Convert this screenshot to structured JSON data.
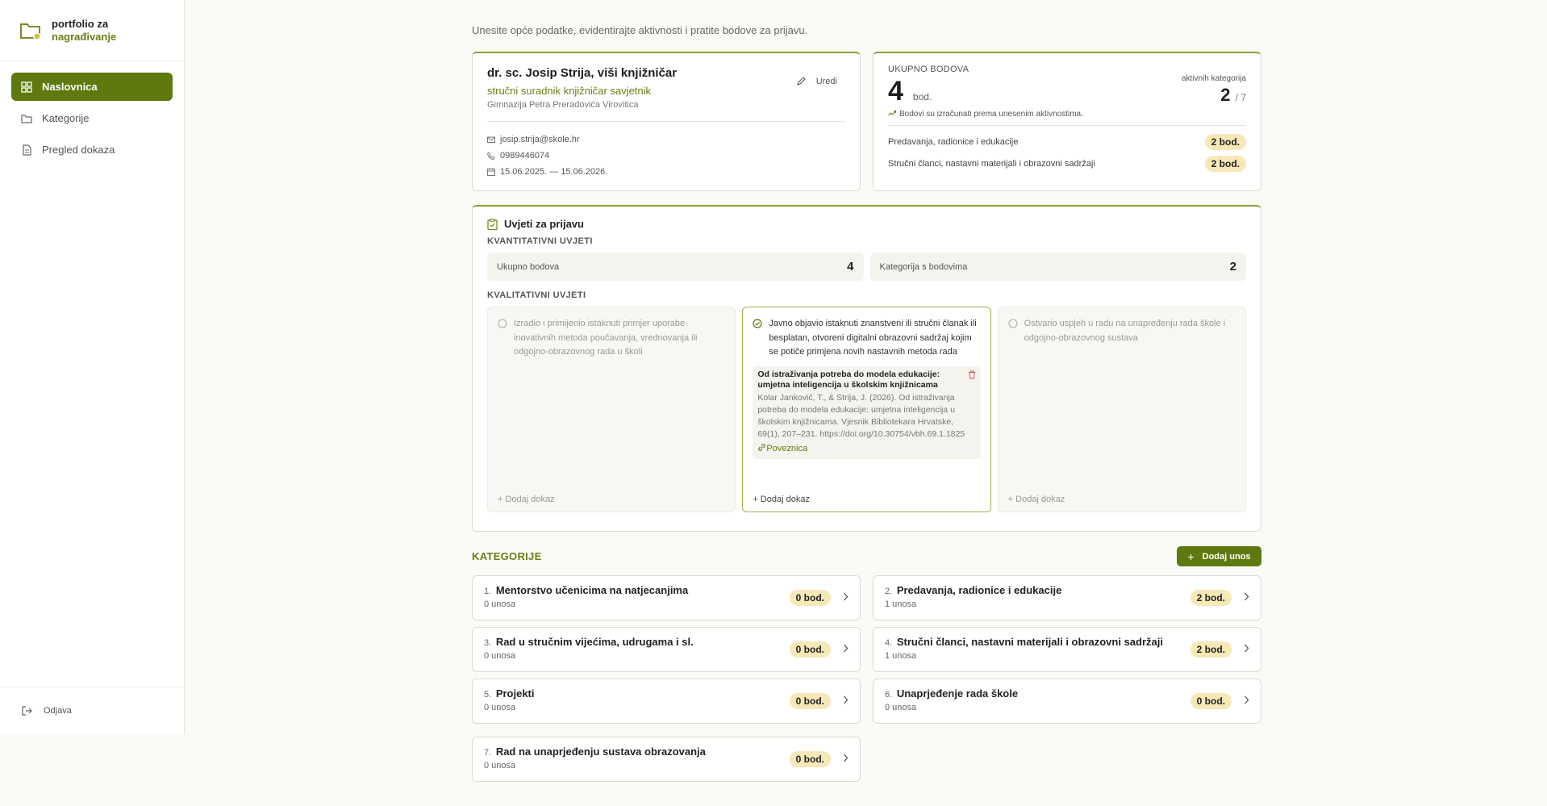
{
  "brand": {
    "line1": "portfolio za",
    "line2": "nagrađivanje"
  },
  "nav": [
    {
      "label": "Naslovnica",
      "icon": "dashboard-icon",
      "active": true
    },
    {
      "label": "Kategorije",
      "icon": "folder-icon"
    },
    {
      "label": "Pregled dokaza",
      "icon": "document-icon"
    }
  ],
  "logout": "Odjava",
  "intro": "Unesite opće podatke, evidentirajte aktivnosti i pratite bodove za prijavu.",
  "profile": {
    "name": "dr. sc. Josip Strija, viši knjižničar",
    "role": "stručni suradnik knjižničar savjetnik",
    "school": "Gimnazija Petra Preradovića Virovitica",
    "edit": "Uredi",
    "email": "josip.strija@skole.hr",
    "phone": "0989446074",
    "period": "15.06.2025. — 15.06.2026."
  },
  "points": {
    "label": "UKUPNO BODOVA",
    "total": "4",
    "unit": "bod.",
    "active_label": "aktivnih kategorija",
    "active_value": "2",
    "active_of": "/ 7",
    "note": "Bodovi su izračunati prema unesenim aktivnostima.",
    "rows": [
      {
        "label": "Predavanja, radionice i edukacije",
        "value": "2 bod."
      },
      {
        "label": "Stručni članci, nastavni materijali i obrazovni sadržaji",
        "value": "2 bod."
      }
    ]
  },
  "conditions": {
    "title": "Uvjeti za prijavu",
    "quant_label": "KVANTITATIVNI UVJETI",
    "quant": [
      {
        "label": "Ukupno bodova",
        "value": "4"
      },
      {
        "label": "Kategorija s bodovima",
        "value": "2"
      }
    ],
    "qual_label": "KVALITATIVNI UVJETI",
    "qual": [
      {
        "text": "Izradio i primijenio istaknuti primjer uporabe inovativnih metoda poučavanja, vrednovanja ili odgojno-obrazovnog rada u školi",
        "add": "+ Dodaj dokaz"
      },
      {
        "text": "Javno objavio istaknuti znanstveni ili stručni članak ili besplatan, otvoreni digitalni obrazovni sadržaj kojim se potiče primjena novih nastavnih metoda rada",
        "add": "+ Dodaj dokaz",
        "evidence": {
          "title": "Od istraživanja potreba do modela edukacije: umjetna inteligencija u školskim knjižnicama",
          "desc": "Kolar Janković, T., & Strija, J. (2026). Od istraživanja potreba do modela edukacije: umjetna inteligencija u školskim knjižnicama. Vjesnik Bibliotekara Hrvatske, 69(1), 207–231. https://doi.org/10.30754/vbh.69.1.1825",
          "link": "Poveznica"
        }
      },
      {
        "text": "Ostvario uspjeh u radu na unapređenju rada škole i odgojno-obrazovnog sustava",
        "add": "+ Dodaj dokaz"
      }
    ]
  },
  "categories": {
    "title": "KATEGORIJE",
    "add": "Dodaj unos",
    "items": [
      {
        "num": "1.",
        "title": "Mentorstvo učenicima na natjecanjima",
        "count": "0 unosa",
        "points": "0 bod."
      },
      {
        "num": "2.",
        "title": "Predavanja, radionice i edukacije",
        "count": "1 unosa",
        "points": "2 bod."
      },
      {
        "num": "3.",
        "title": "Rad u stručnim vijećima, udrugama i sl.",
        "count": "0 unosa",
        "points": "0 bod."
      },
      {
        "num": "4.",
        "title": "Stručni članci, nastavni materijali i obrazovni sadržaji",
        "count": "1 unosa",
        "points": "2 bod."
      },
      {
        "num": "5.",
        "title": "Projekti",
        "count": "0 unosa",
        "points": "0 bod."
      },
      {
        "num": "6.",
        "title": "Unaprjeđenje rada škole",
        "count": "0 unosa",
        "points": "0 bod."
      },
      {
        "num": "7.",
        "title": "Rad na unaprjeđenju sustava obrazovanja",
        "count": "0 unosa",
        "points": "0 bod."
      }
    ]
  },
  "colors": {
    "accent": "#5e7a0f",
    "accent_text": "#6b7f14",
    "badge": "#f7e8b8"
  }
}
